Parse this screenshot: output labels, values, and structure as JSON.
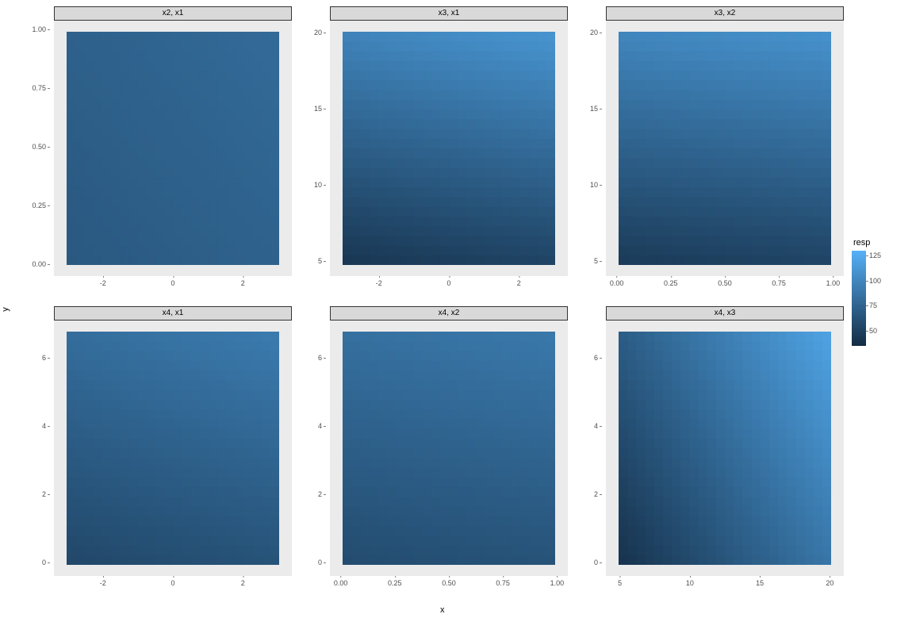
{
  "axis": {
    "x": "x",
    "y": "y"
  },
  "legend": {
    "title": "resp",
    "range_min": 35,
    "range_max": 130,
    "ticks": [
      {
        "label": "125",
        "value": 125
      },
      {
        "label": "100",
        "value": 100
      },
      {
        "label": "75",
        "value": 75
      },
      {
        "label": "50",
        "value": 50
      }
    ],
    "color_low": "#132b43",
    "color_high": "#56b1f7"
  },
  "panels": [
    {
      "id": "p_x2_x1",
      "strip": "x2, x1",
      "x_ticks": [
        "-2",
        "0",
        "2"
      ],
      "y_ticks": [
        "0.00",
        "0.25",
        "0.50",
        "0.75",
        "1.00"
      ],
      "x_range": [
        -3.4,
        3.4
      ],
      "y_range": [
        -0.05,
        1.05
      ],
      "gradient": {
        "tl": 73,
        "tr": 80,
        "bl": 67,
        "br": 74
      }
    },
    {
      "id": "p_x3_x1",
      "strip": "x3, x1",
      "x_ticks": [
        "-2",
        "0",
        "2"
      ],
      "y_ticks": [
        "5",
        "10",
        "15",
        "20"
      ],
      "x_range": [
        -3.4,
        3.4
      ],
      "y_range": [
        4,
        21
      ],
      "gradient": {
        "tl": 98,
        "tr": 110,
        "bl": 43,
        "br": 52
      }
    },
    {
      "id": "p_x3_x2",
      "strip": "x3, x2",
      "x_ticks": [
        "0.00",
        "0.25",
        "0.50",
        "0.75",
        "1.00"
      ],
      "y_ticks": [
        "5",
        "10",
        "15",
        "20"
      ],
      "x_range": [
        -0.05,
        1.05
      ],
      "y_range": [
        4,
        21
      ],
      "gradient": {
        "tl": 100,
        "tr": 108,
        "bl": 46,
        "br": 52
      }
    },
    {
      "id": "p_x4_x1",
      "strip": "x4, x1",
      "x_ticks": [
        "-2",
        "0",
        "2"
      ],
      "y_ticks": [
        "0",
        "2",
        "4",
        "6"
      ],
      "x_range": [
        -3.4,
        3.4
      ],
      "y_range": [
        -0.4,
        7.2
      ],
      "gradient": {
        "tl": 82,
        "tr": 92,
        "bl": 55,
        "br": 63
      }
    },
    {
      "id": "p_x4_x2",
      "strip": "x4, x2",
      "x_ticks": [
        "0.00",
        "0.25",
        "0.50",
        "0.75",
        "1.00"
      ],
      "y_ticks": [
        "0",
        "2",
        "4",
        "6"
      ],
      "x_range": [
        -0.05,
        1.05
      ],
      "y_range": [
        -0.4,
        7.2
      ],
      "gradient": {
        "tl": 84,
        "tr": 90,
        "bl": 58,
        "br": 63
      }
    },
    {
      "id": "p_x4_x3",
      "strip": "x4, x3",
      "x_ticks": [
        "5",
        "10",
        "15",
        "20"
      ],
      "y_ticks": [
        "0",
        "2",
        "4",
        "6"
      ],
      "x_range": [
        4,
        21
      ],
      "y_range": [
        -0.4,
        7.2
      ],
      "gradient": {
        "tl": 70,
        "tr": 120,
        "bl": 40,
        "br": 88
      }
    }
  ],
  "chart_data": [
    {
      "type": "heatmap",
      "title": "x2, x1",
      "xlabel": "x",
      "ylabel": "y",
      "x_range": [
        -3.4,
        3.4
      ],
      "y_range": [
        -0.05,
        1.05
      ],
      "corner_values": {
        "bottom_left": 67,
        "bottom_right": 74,
        "top_left": 73,
        "top_right": 80
      },
      "color_scale": {
        "name": "resp",
        "min": 35,
        "max": 130,
        "low": "#132b43",
        "high": "#56b1f7"
      }
    },
    {
      "type": "heatmap",
      "title": "x3, x1",
      "xlabel": "x",
      "ylabel": "y",
      "x_range": [
        -3.4,
        3.4
      ],
      "y_range": [
        4,
        21
      ],
      "corner_values": {
        "bottom_left": 43,
        "bottom_right": 52,
        "top_left": 98,
        "top_right": 110
      },
      "color_scale": {
        "name": "resp",
        "min": 35,
        "max": 130,
        "low": "#132b43",
        "high": "#56b1f7"
      }
    },
    {
      "type": "heatmap",
      "title": "x3, x2",
      "xlabel": "x",
      "ylabel": "y",
      "x_range": [
        -0.05,
        1.05
      ],
      "y_range": [
        4,
        21
      ],
      "corner_values": {
        "bottom_left": 46,
        "bottom_right": 52,
        "top_left": 100,
        "top_right": 108
      },
      "color_scale": {
        "name": "resp",
        "min": 35,
        "max": 130,
        "low": "#132b43",
        "high": "#56b1f7"
      }
    },
    {
      "type": "heatmap",
      "title": "x4, x1",
      "xlabel": "x",
      "ylabel": "y",
      "x_range": [
        -3.4,
        3.4
      ],
      "y_range": [
        -0.4,
        7.2
      ],
      "corner_values": {
        "bottom_left": 55,
        "bottom_right": 63,
        "top_left": 82,
        "top_right": 92
      },
      "color_scale": {
        "name": "resp",
        "min": 35,
        "max": 130,
        "low": "#132b43",
        "high": "#56b1f7"
      }
    },
    {
      "type": "heatmap",
      "title": "x4, x2",
      "xlabel": "x",
      "ylabel": "y",
      "x_range": [
        -0.05,
        1.05
      ],
      "y_range": [
        -0.4,
        7.2
      ],
      "corner_values": {
        "bottom_left": 58,
        "bottom_right": 63,
        "top_left": 84,
        "top_right": 90
      },
      "color_scale": {
        "name": "resp",
        "min": 35,
        "max": 130,
        "low": "#132b43",
        "high": "#56b1f7"
      }
    },
    {
      "type": "heatmap",
      "title": "x4, x3",
      "xlabel": "x",
      "ylabel": "y",
      "x_range": [
        4,
        21
      ],
      "y_range": [
        -0.4,
        7.2
      ],
      "corner_values": {
        "bottom_left": 40,
        "bottom_right": 88,
        "top_left": 70,
        "top_right": 120
      },
      "color_scale": {
        "name": "resp",
        "min": 35,
        "max": 130,
        "low": "#132b43",
        "high": "#56b1f7"
      }
    }
  ]
}
